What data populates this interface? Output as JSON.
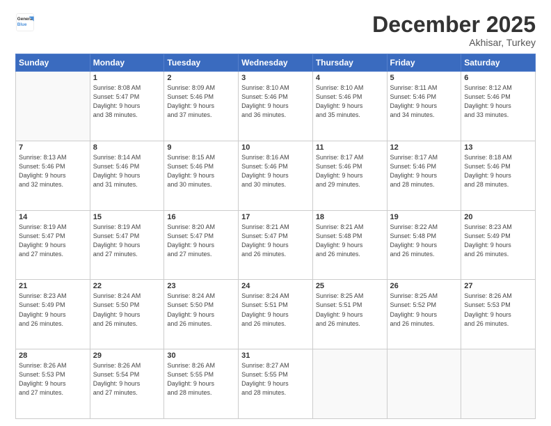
{
  "header": {
    "logo_general": "General",
    "logo_blue": "Blue",
    "month_title": "December 2025",
    "subtitle": "Akhisar, Turkey"
  },
  "days_of_week": [
    "Sunday",
    "Monday",
    "Tuesday",
    "Wednesday",
    "Thursday",
    "Friday",
    "Saturday"
  ],
  "weeks": [
    [
      {
        "day": "",
        "info": ""
      },
      {
        "day": "1",
        "info": "Sunrise: 8:08 AM\nSunset: 5:47 PM\nDaylight: 9 hours\nand 38 minutes."
      },
      {
        "day": "2",
        "info": "Sunrise: 8:09 AM\nSunset: 5:46 PM\nDaylight: 9 hours\nand 37 minutes."
      },
      {
        "day": "3",
        "info": "Sunrise: 8:10 AM\nSunset: 5:46 PM\nDaylight: 9 hours\nand 36 minutes."
      },
      {
        "day": "4",
        "info": "Sunrise: 8:10 AM\nSunset: 5:46 PM\nDaylight: 9 hours\nand 35 minutes."
      },
      {
        "day": "5",
        "info": "Sunrise: 8:11 AM\nSunset: 5:46 PM\nDaylight: 9 hours\nand 34 minutes."
      },
      {
        "day": "6",
        "info": "Sunrise: 8:12 AM\nSunset: 5:46 PM\nDaylight: 9 hours\nand 33 minutes."
      }
    ],
    [
      {
        "day": "7",
        "info": "Sunrise: 8:13 AM\nSunset: 5:46 PM\nDaylight: 9 hours\nand 32 minutes."
      },
      {
        "day": "8",
        "info": "Sunrise: 8:14 AM\nSunset: 5:46 PM\nDaylight: 9 hours\nand 31 minutes."
      },
      {
        "day": "9",
        "info": "Sunrise: 8:15 AM\nSunset: 5:46 PM\nDaylight: 9 hours\nand 30 minutes."
      },
      {
        "day": "10",
        "info": "Sunrise: 8:16 AM\nSunset: 5:46 PM\nDaylight: 9 hours\nand 30 minutes."
      },
      {
        "day": "11",
        "info": "Sunrise: 8:17 AM\nSunset: 5:46 PM\nDaylight: 9 hours\nand 29 minutes."
      },
      {
        "day": "12",
        "info": "Sunrise: 8:17 AM\nSunset: 5:46 PM\nDaylight: 9 hours\nand 28 minutes."
      },
      {
        "day": "13",
        "info": "Sunrise: 8:18 AM\nSunset: 5:46 PM\nDaylight: 9 hours\nand 28 minutes."
      }
    ],
    [
      {
        "day": "14",
        "info": "Sunrise: 8:19 AM\nSunset: 5:47 PM\nDaylight: 9 hours\nand 27 minutes."
      },
      {
        "day": "15",
        "info": "Sunrise: 8:19 AM\nSunset: 5:47 PM\nDaylight: 9 hours\nand 27 minutes."
      },
      {
        "day": "16",
        "info": "Sunrise: 8:20 AM\nSunset: 5:47 PM\nDaylight: 9 hours\nand 27 minutes."
      },
      {
        "day": "17",
        "info": "Sunrise: 8:21 AM\nSunset: 5:47 PM\nDaylight: 9 hours\nand 26 minutes."
      },
      {
        "day": "18",
        "info": "Sunrise: 8:21 AM\nSunset: 5:48 PM\nDaylight: 9 hours\nand 26 minutes."
      },
      {
        "day": "19",
        "info": "Sunrise: 8:22 AM\nSunset: 5:48 PM\nDaylight: 9 hours\nand 26 minutes."
      },
      {
        "day": "20",
        "info": "Sunrise: 8:23 AM\nSunset: 5:49 PM\nDaylight: 9 hours\nand 26 minutes."
      }
    ],
    [
      {
        "day": "21",
        "info": "Sunrise: 8:23 AM\nSunset: 5:49 PM\nDaylight: 9 hours\nand 26 minutes."
      },
      {
        "day": "22",
        "info": "Sunrise: 8:24 AM\nSunset: 5:50 PM\nDaylight: 9 hours\nand 26 minutes."
      },
      {
        "day": "23",
        "info": "Sunrise: 8:24 AM\nSunset: 5:50 PM\nDaylight: 9 hours\nand 26 minutes."
      },
      {
        "day": "24",
        "info": "Sunrise: 8:24 AM\nSunset: 5:51 PM\nDaylight: 9 hours\nand 26 minutes."
      },
      {
        "day": "25",
        "info": "Sunrise: 8:25 AM\nSunset: 5:51 PM\nDaylight: 9 hours\nand 26 minutes."
      },
      {
        "day": "26",
        "info": "Sunrise: 8:25 AM\nSunset: 5:52 PM\nDaylight: 9 hours\nand 26 minutes."
      },
      {
        "day": "27",
        "info": "Sunrise: 8:26 AM\nSunset: 5:53 PM\nDaylight: 9 hours\nand 26 minutes."
      }
    ],
    [
      {
        "day": "28",
        "info": "Sunrise: 8:26 AM\nSunset: 5:53 PM\nDaylight: 9 hours\nand 27 minutes."
      },
      {
        "day": "29",
        "info": "Sunrise: 8:26 AM\nSunset: 5:54 PM\nDaylight: 9 hours\nand 27 minutes."
      },
      {
        "day": "30",
        "info": "Sunrise: 8:26 AM\nSunset: 5:55 PM\nDaylight: 9 hours\nand 28 minutes."
      },
      {
        "day": "31",
        "info": "Sunrise: 8:27 AM\nSunset: 5:55 PM\nDaylight: 9 hours\nand 28 minutes."
      },
      {
        "day": "",
        "info": ""
      },
      {
        "day": "",
        "info": ""
      },
      {
        "day": "",
        "info": ""
      }
    ]
  ]
}
